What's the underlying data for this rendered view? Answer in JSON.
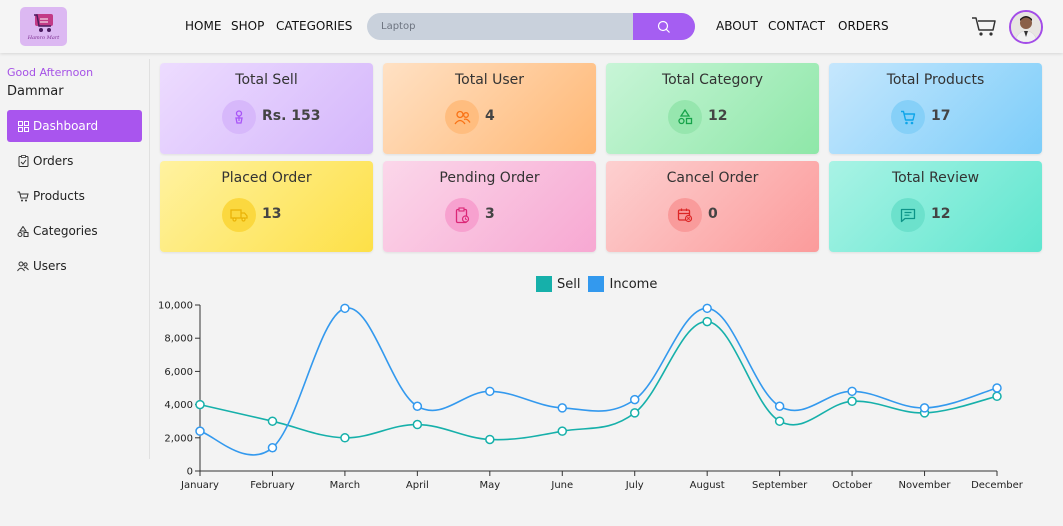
{
  "header": {
    "logo_text": "Hamro Mart",
    "nav_left": [
      "HOME",
      "SHOP",
      "CATEGORIES"
    ],
    "search_placeholder": "Laptop",
    "nav_right": [
      "ABOUT",
      "CONTACT",
      "ORDERS"
    ]
  },
  "sidebar": {
    "greeting": "Good Afternoon",
    "username": "Dammar",
    "items": [
      {
        "label": "Dashboard",
        "icon": "dashboard-icon",
        "active": true
      },
      {
        "label": "Orders",
        "icon": "clipboard-icon",
        "active": false
      },
      {
        "label": "Products",
        "icon": "cart-icon",
        "active": false
      },
      {
        "label": "Categories",
        "icon": "shapes-icon",
        "active": false
      },
      {
        "label": "Users",
        "icon": "users-icon",
        "active": false
      }
    ]
  },
  "cards": [
    {
      "title": "Total Sell",
      "value": "Rs. 153",
      "icon": "money-icon",
      "color": "#a855f7"
    },
    {
      "title": "Total User",
      "value": "4",
      "icon": "users-icon",
      "color": "#f97316"
    },
    {
      "title": "Total Category",
      "value": "12",
      "icon": "shapes-icon",
      "color": "#16a34a"
    },
    {
      "title": "Total Products",
      "value": "17",
      "icon": "cart-icon",
      "color": "#0ea5e9"
    },
    {
      "title": "Placed Order",
      "value": "13",
      "icon": "truck-icon",
      "color": "#eab308"
    },
    {
      "title": "Pending Order",
      "value": "3",
      "icon": "clipboard-clock-icon",
      "color": "#db2777"
    },
    {
      "title": "Cancel Order",
      "value": "0",
      "icon": "calendar-cancel-icon",
      "color": "#dc2626"
    },
    {
      "title": "Total Review",
      "value": "12",
      "icon": "review-icon",
      "color": "#0d9488"
    }
  ],
  "chart_data": {
    "type": "line",
    "categories": [
      "January",
      "February",
      "March",
      "April",
      "May",
      "June",
      "July",
      "August",
      "September",
      "October",
      "November",
      "December"
    ],
    "series": [
      {
        "name": "Sell",
        "color": "#16b0aa",
        "values": [
          4000,
          3000,
          2000,
          2800,
          1900,
          2400,
          3500,
          9000,
          3000,
          4200,
          3500,
          4500
        ]
      },
      {
        "name": "Income",
        "color": "#3399ee",
        "values": [
          2400,
          1400,
          9800,
          3900,
          4800,
          3800,
          4300,
          9800,
          3900,
          4800,
          3800,
          5000
        ]
      }
    ],
    "ylim": [
      0,
      10000
    ],
    "yticks": [
      "0",
      "2,000",
      "4,000",
      "6,000",
      "8,000",
      "10,000"
    ],
    "legend_position": "top-center",
    "grid": false
  }
}
